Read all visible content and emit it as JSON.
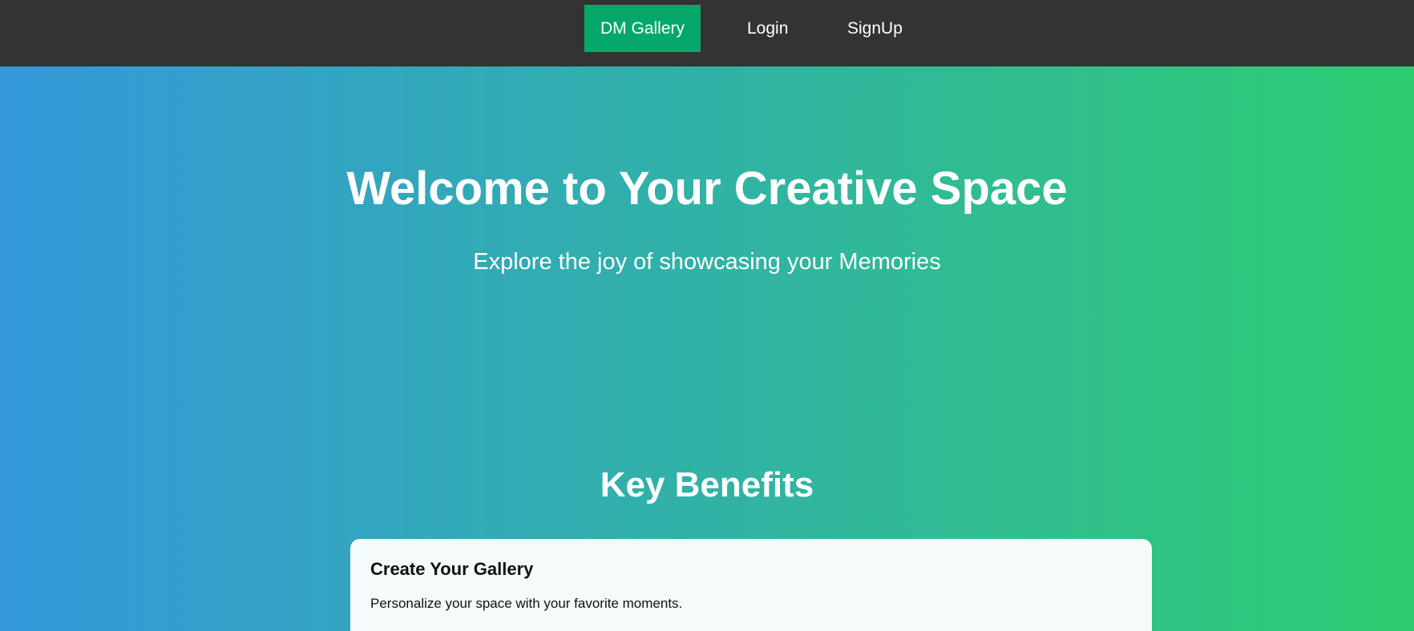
{
  "nav": {
    "brand": "DM Gallery",
    "login": "Login",
    "signup": "SignUp"
  },
  "hero": {
    "title": "Welcome to Your Creative Space",
    "subtitle": "Explore the joy of showcasing your Memories"
  },
  "benefits": {
    "heading": "Key Benefits",
    "items": [
      {
        "title": "Create Your Gallery",
        "description": "Personalize your space with your favorite moments."
      }
    ]
  },
  "colors": {
    "navbar_bg": "#333333",
    "active_link_bg": "#04a96a",
    "gradient_start": "#3498db",
    "gradient_end": "#2ecc71",
    "card_bg": "#f4fbfa"
  }
}
